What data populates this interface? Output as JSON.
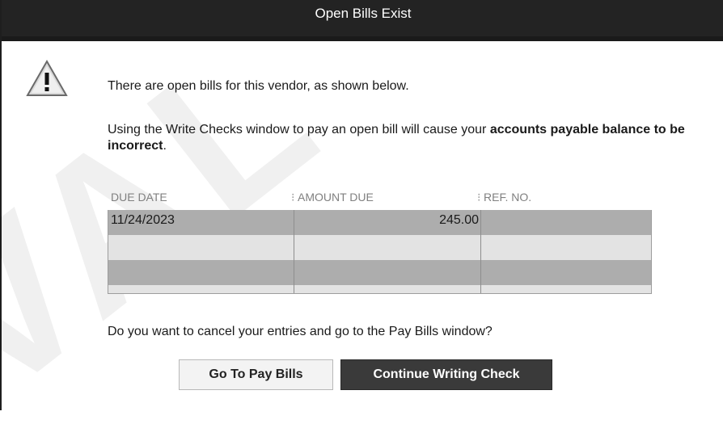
{
  "dialog": {
    "title": "Open Bills Exist",
    "icon": "warning-triangle-icon",
    "message_line1": "There are open bills for this vendor, as shown below.",
    "message_line2_prefix": "Using the Write Checks window to pay an open bill will cause your ",
    "message_line2_bold": "accounts payable balance to be incorrect",
    "message_line2_suffix": ".",
    "question": "Do you want to cancel your entries and go to the Pay Bills window?"
  },
  "watermark": {
    "text": "VAL"
  },
  "table": {
    "columns": [
      "DUE DATE",
      "AMOUNT DUE",
      "REF. NO."
    ],
    "rows": [
      [
        "11/24/2023",
        "245.00",
        ""
      ],
      [
        "",
        "",
        ""
      ],
      [
        "",
        "",
        ""
      ]
    ]
  },
  "buttons": {
    "go_to_pay_bills": "Go To Pay Bills",
    "continue_writing_check": "Continue Writing Check"
  },
  "colors": {
    "titlebar": "#232323",
    "row_selected": "#adadad",
    "row_alt": "#e3e3e3",
    "primary_button": "#3a3a3a"
  }
}
